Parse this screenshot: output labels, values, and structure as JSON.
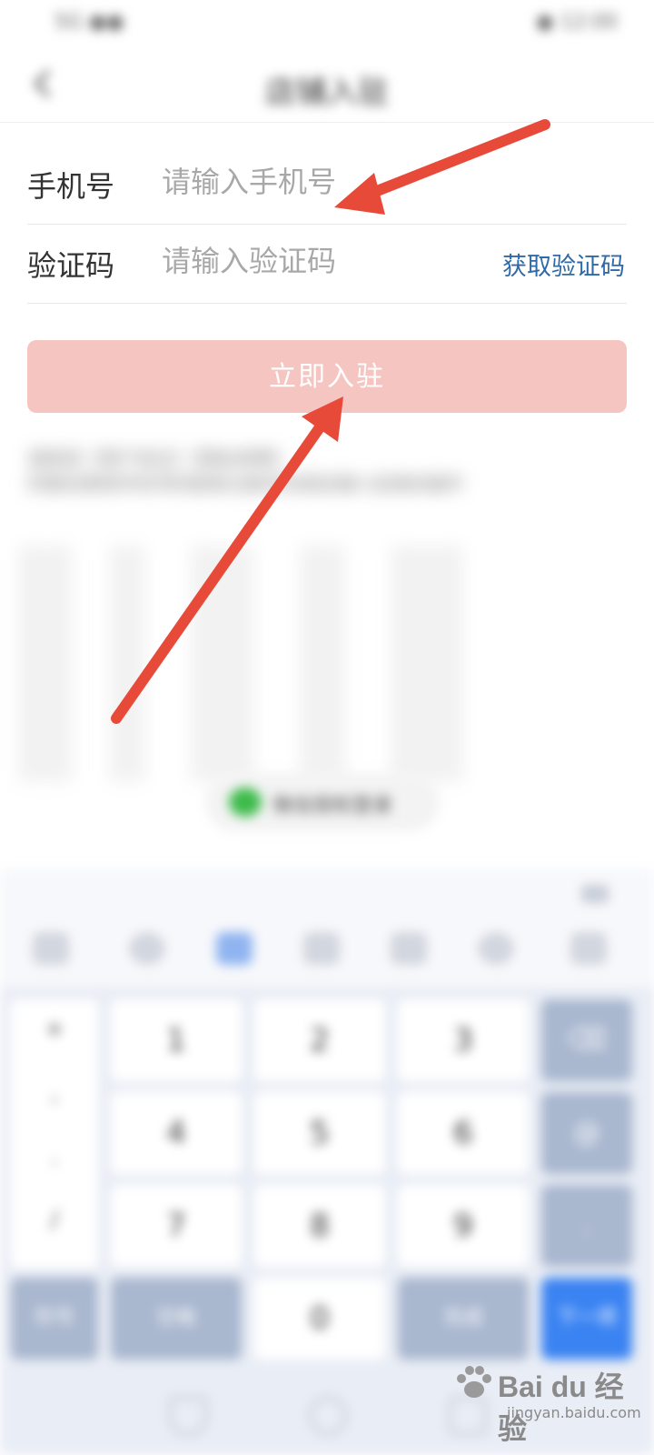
{
  "status_bar": {
    "left": "5G ●●",
    "right": "● 12:00"
  },
  "nav": {
    "title": "店铺入驻"
  },
  "form": {
    "phone": {
      "label": "手机号",
      "placeholder": "请输入手机号"
    },
    "code": {
      "label": "验证码",
      "placeholder": "请输入验证码",
      "get_code": "获取验证码"
    },
    "submit": "立即入驻"
  },
  "agreement": {
    "line1": "请阅读《用户协议》《隐私政策》",
    "line2": "同意后使用手机号码登录注册并完成店铺入驻相关操作"
  },
  "wechat": {
    "label": "微信授权登录"
  },
  "keyboard": {
    "symbols": [
      "+",
      ",",
      ".",
      "/"
    ],
    "digits": [
      "1",
      "2",
      "3",
      "4",
      "5",
      "6",
      "7",
      "8",
      "9"
    ],
    "zero": "0",
    "bottom": {
      "symbol": "符号",
      "space": "空格",
      "done": "完成",
      "next": "下一项"
    },
    "delete": "⌫",
    "at": "@",
    "dot": "."
  },
  "watermark": {
    "main": "Bai du 经验",
    "sub": "jingyan.baidu.com"
  },
  "colors": {
    "accent": "#e84a3a",
    "button": "#f5c5c1",
    "link": "#2f6aa8",
    "keyboard_blue": "#3a83f2"
  }
}
